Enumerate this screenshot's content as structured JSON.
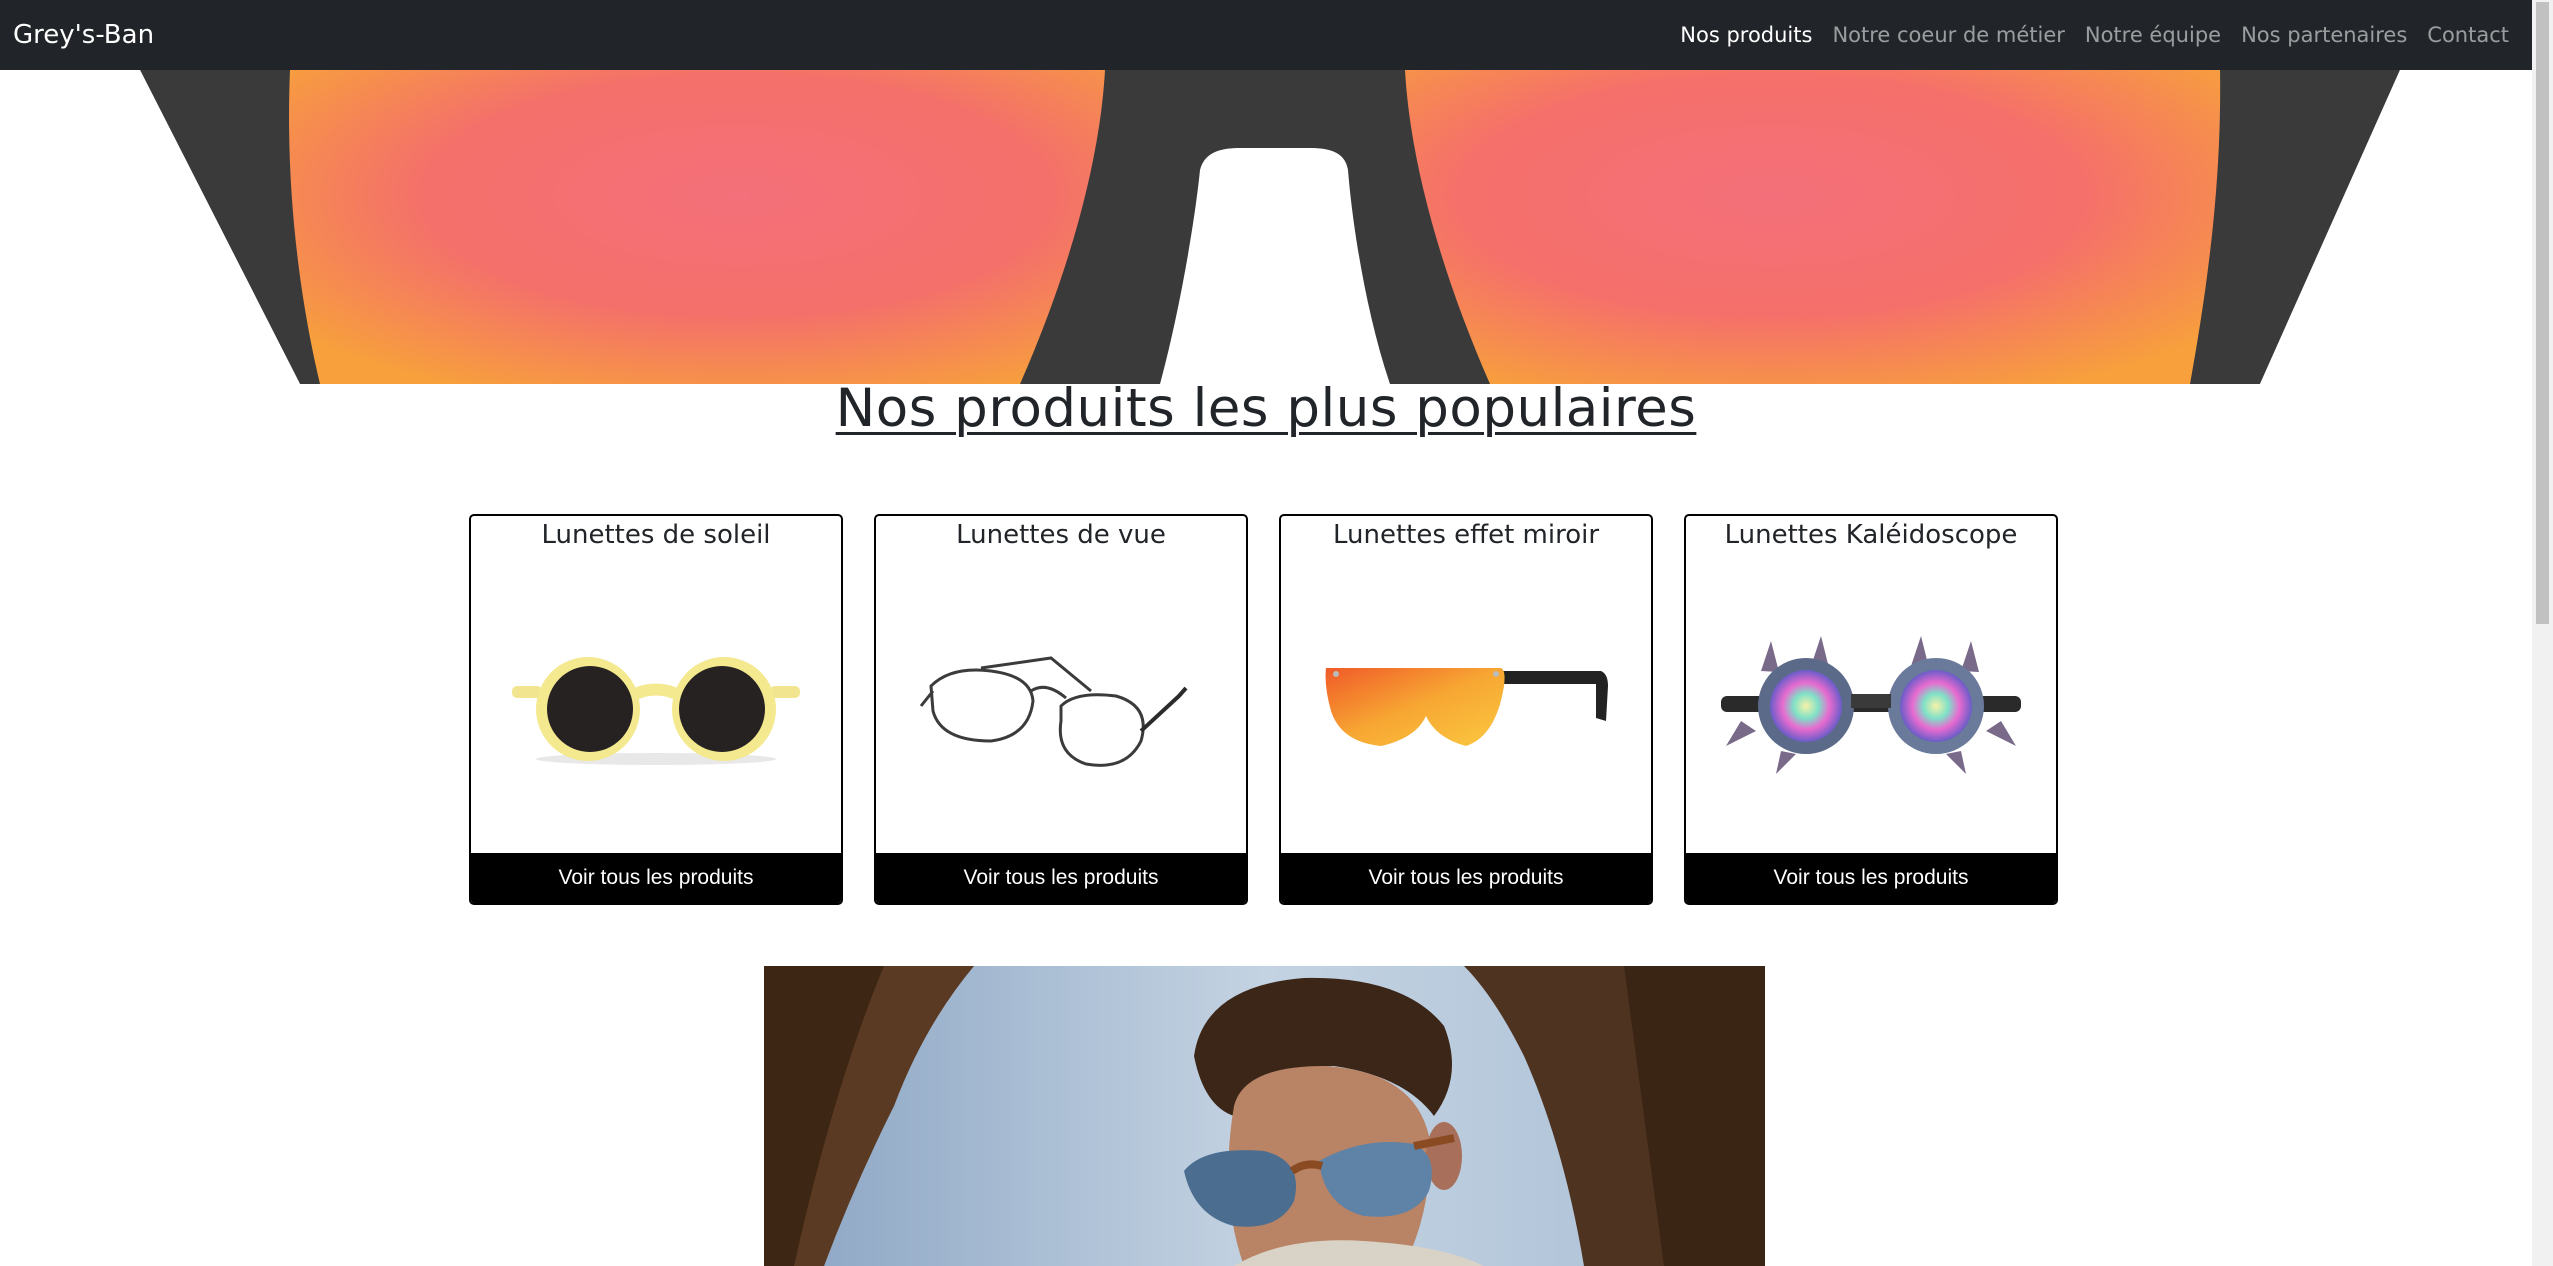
{
  "navbar": {
    "brand": "Grey's-Ban",
    "links": [
      {
        "label": "Nos produits",
        "active": true
      },
      {
        "label": "Notre coeur de métier",
        "active": false
      },
      {
        "label": "Notre équipe",
        "active": false
      },
      {
        "label": "Nos partenaires",
        "active": false
      },
      {
        "label": "Contact",
        "active": false
      }
    ]
  },
  "section": {
    "title": "Nos produits les plus populaires"
  },
  "cards": [
    {
      "title": "Lunettes de soleil",
      "button": "Voir tous les produits",
      "icon": "yellow-round-sunglasses"
    },
    {
      "title": "Lunettes de vue",
      "button": "Voir tous les produits",
      "icon": "wire-frame-eyeglasses"
    },
    {
      "title": "Lunettes effet miroir",
      "button": "Voir tous les produits",
      "icon": "mirror-shield-sunglasses"
    },
    {
      "title": "Lunettes Kaléidoscope",
      "button": "Voir tous les produits",
      "icon": "kaleidoscope-spiked-goggles"
    }
  ],
  "colors": {
    "navbar_bg": "#212529",
    "button_bg": "#000000",
    "hero_lens": "#f4726a",
    "hero_frame": "#3b3b3b"
  }
}
